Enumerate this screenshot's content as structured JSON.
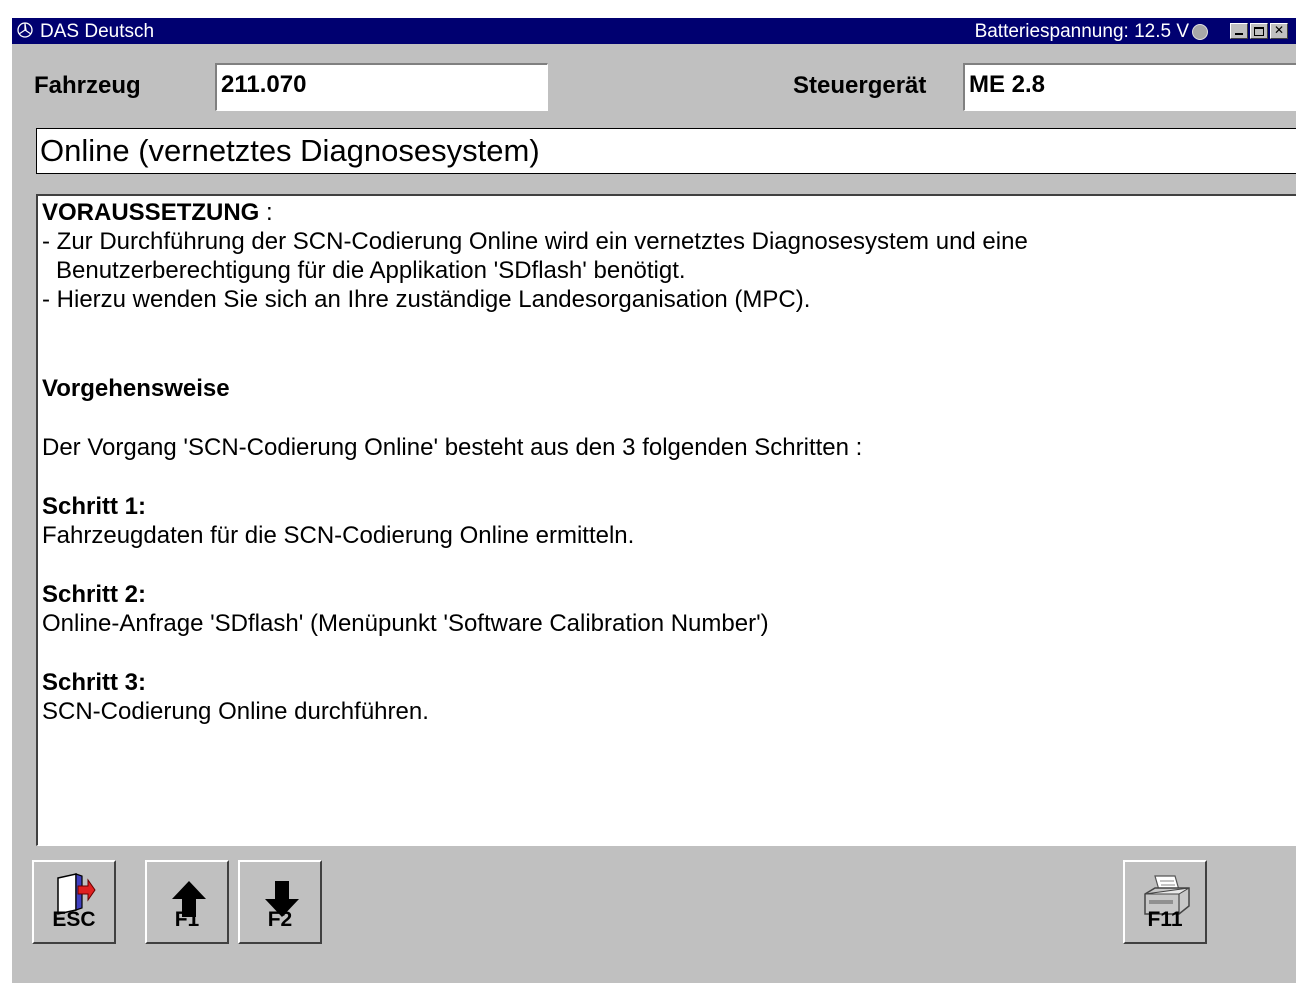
{
  "titlebar": {
    "title": "DAS Deutsch",
    "battery": "Batteriespannung: 12.5 V"
  },
  "header": {
    "vehicle_label": "Fahrzeug",
    "vehicle_value": "211.070",
    "ecu_label": "Steuergerät",
    "ecu_value": "ME 2.8"
  },
  "page_title": "Online (vernetztes Diagnosesystem)",
  "content": {
    "prereq_heading": "VORAUSSETZUNG",
    "prereq_colon": " :",
    "prereq_line1": "- Zur Durchführung der SCN-Codierung Online wird ein vernetztes Diagnosesystem und eine",
    "prereq_line2": "Benutzerberechtigung für die Applikation 'SDflash' benötigt.",
    "prereq_line3": "- Hierzu wenden Sie sich an Ihre zuständige Landesorganisation (MPC).",
    "procedure_heading": "Vorgehensweise",
    "intro": "Der Vorgang 'SCN-Codierung Online' besteht aus den 3 folgenden Schritten :",
    "steps": [
      {
        "title": "Schritt 1:",
        "text": "Fahrzeugdaten für die SCN-Codierung Online ermitteln."
      },
      {
        "title": "Schritt 2:",
        "text": "Online-Anfrage 'SDflash' (Menüpunkt 'Software Calibration Number')"
      },
      {
        "title": "Schritt 3:",
        "text": "SCN-Codierung Online durchführen."
      }
    ]
  },
  "function_keys": {
    "esc": "ESC",
    "f1": "F1",
    "f2": "F2",
    "f11": "F11"
  },
  "colors": {
    "titlebar": "#000070",
    "window": "#c0c0c0"
  },
  "icons": {
    "esc": "exit-door-icon",
    "f1": "arrow-up-icon",
    "f2": "arrow-down-icon",
    "f11": "printer-icon"
  }
}
